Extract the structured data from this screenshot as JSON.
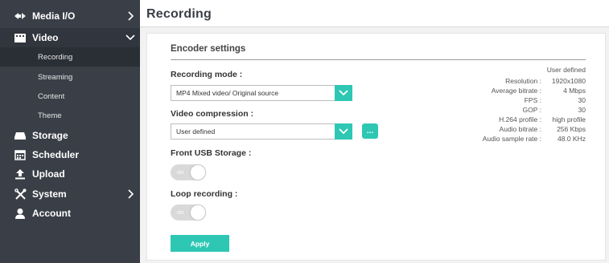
{
  "sidebar": {
    "items": [
      {
        "label": "Media I/O",
        "icon": "media-io-icon"
      },
      {
        "label": "Video",
        "icon": "video-icon"
      },
      {
        "label": "Storage",
        "icon": "storage-icon"
      },
      {
        "label": "Scheduler",
        "icon": "calendar-icon"
      },
      {
        "label": "Upload",
        "icon": "upload-icon"
      },
      {
        "label": "System",
        "icon": "tools-icon"
      },
      {
        "label": "Account",
        "icon": "user-icon"
      }
    ],
    "video_sub": [
      {
        "label": "Recording"
      },
      {
        "label": "Streaming"
      },
      {
        "label": "Content"
      },
      {
        "label": "Theme"
      }
    ]
  },
  "header": {
    "title": "Recording"
  },
  "encoder": {
    "section_title": "Encoder settings",
    "recording_mode_label": "Recording mode :",
    "recording_mode_value": "MP4 Mixed video/ Original source",
    "video_compression_label": "Video compression :",
    "video_compression_value": "User defined",
    "more_label": "...",
    "front_usb_label": "Front USB Storage :",
    "front_usb_toggle": "on",
    "loop_recording_label": "Loop recording :",
    "loop_recording_toggle": "on",
    "apply_label": "Apply"
  },
  "info": {
    "defined": "User defined",
    "rows": [
      {
        "k": "Resolution :",
        "v": "1920x1080"
      },
      {
        "k": "Average bitrate :",
        "v": "4 Mbps"
      },
      {
        "k": "FPS :",
        "v": "30"
      },
      {
        "k": "GOP :",
        "v": "30"
      },
      {
        "k": "H.264 profile :",
        "v": "high profile"
      },
      {
        "k": "Audio bitrate :",
        "v": "256 Kbps"
      },
      {
        "k": "Audio sample rate :",
        "v": "48.0 KHz"
      }
    ]
  },
  "colors": {
    "accent": "#2ec7b3",
    "sidebar": "#3a3f47"
  }
}
